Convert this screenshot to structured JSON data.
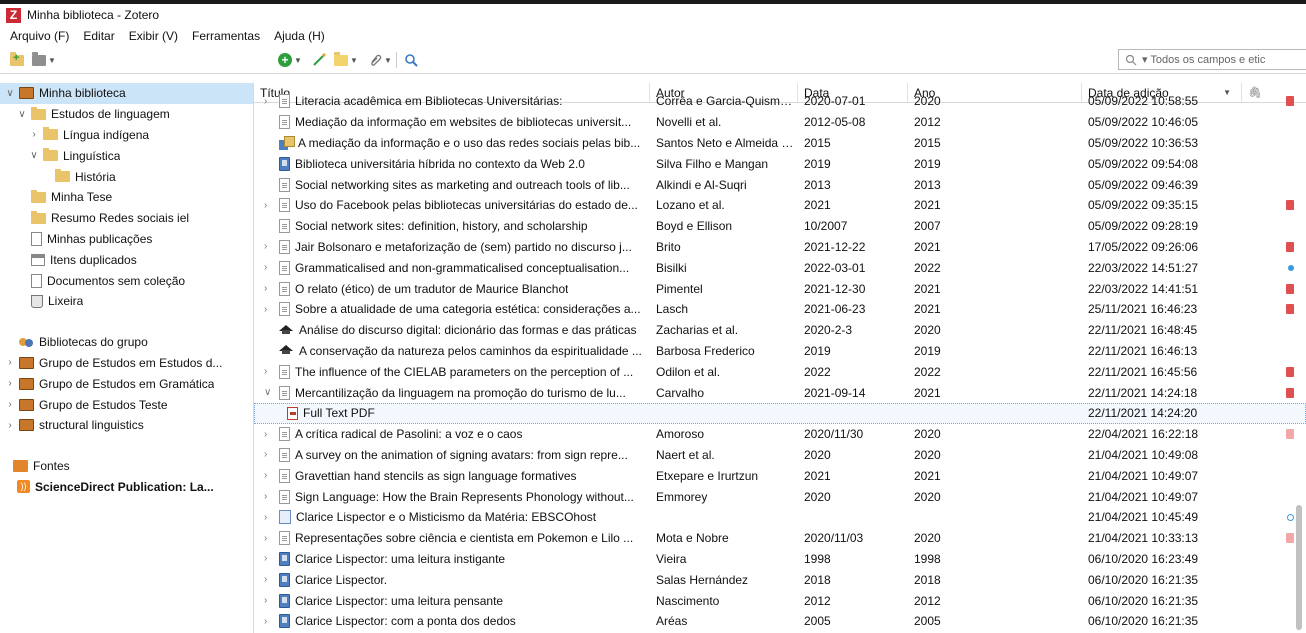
{
  "window": {
    "title": "Minha biblioteca - Zotero",
    "logo_letter": "Z"
  },
  "menu": [
    "Arquivo (F)",
    "Editar",
    "Exibir (V)",
    "Ferramentas",
    "Ajuda (H)"
  ],
  "toolbar": {
    "search_placeholder": "▾ Todos os campos e etic"
  },
  "sidebar": {
    "items": [
      {
        "label": "Minha biblioteca",
        "icon": "library-icon",
        "twisty": "∨",
        "indent": 0,
        "selected": true
      },
      {
        "label": "Estudos de linguagem",
        "icon": "folder-icon",
        "twisty": "∨",
        "indent": 1
      },
      {
        "label": "Língua indígena",
        "icon": "folder-icon",
        "twisty": "›",
        "indent": 2
      },
      {
        "label": "Linguística",
        "icon": "folder-icon",
        "twisty": "∨",
        "indent": 2
      },
      {
        "label": "História",
        "icon": "folder-icon",
        "twisty": "",
        "indent": 3
      },
      {
        "label": "Minha Tese",
        "icon": "folder-icon",
        "twisty": "",
        "indent": 1
      },
      {
        "label": "Resumo Redes sociais iel",
        "icon": "folder-icon",
        "twisty": "",
        "indent": 1
      },
      {
        "label": "Minhas publicações",
        "icon": "document-icon",
        "twisty": "",
        "indent": 1
      },
      {
        "label": "Itens duplicados",
        "icon": "duplicates-icon",
        "twisty": "",
        "indent": 1
      },
      {
        "label": "Documentos sem coleção",
        "icon": "unfiled-icon",
        "twisty": "",
        "indent": 1
      },
      {
        "label": "Lixeira",
        "icon": "trash-icon",
        "twisty": "",
        "indent": 1
      }
    ],
    "groups_header": "Bibliotecas do grupo",
    "groups": [
      "Grupo de Estudos em Estudos d...",
      "Grupo de Estudos em Gramática",
      "Grupo de Estudos Teste",
      "structural linguistics"
    ],
    "feeds_header": "Fontes",
    "feeds": [
      "ScienceDirect Publication: La..."
    ]
  },
  "columns": {
    "title": "Título",
    "author": "Autor",
    "date": "Data",
    "year": "Ano",
    "added": "Data de adição"
  },
  "rows": [
    {
      "title": "Literacia acadêmica em Bibliotecas Universitárias:",
      "author": "Corrêa e Garcia-Quismondo",
      "date": "2020-07-01",
      "year": "2020",
      "added": "05/09/2022 10:58:55",
      "type": "document",
      "twisty": "›",
      "att": "pdf",
      "partial": true
    },
    {
      "title": "Mediação da informação em websites de bibliotecas universit...",
      "author": "Novelli et al.",
      "date": "2012-05-08",
      "year": "2012",
      "added": "05/09/2022 10:46:05",
      "type": "document",
      "twisty": "",
      "att": ""
    },
    {
      "title": "A mediação da informação e o uso das redes sociais pelas bib...",
      "author": "Santos Neto e Almeida Ju...",
      "date": "2015",
      "year": "2015",
      "added": "05/09/2022 10:36:53",
      "type": "chapter",
      "twisty": "",
      "att": ""
    },
    {
      "title": "Biblioteca universitária híbrida no contexto da Web 2.0",
      "author": "Silva Filho e Mangan",
      "date": "2019",
      "year": "2019",
      "added": "05/09/2022 09:54:08",
      "type": "book",
      "twisty": "",
      "att": ""
    },
    {
      "title": "Social networking sites as marketing and outreach tools of lib...",
      "author": "Alkindi e Al-Suqri",
      "date": "2013",
      "year": "2013",
      "added": "05/09/2022 09:46:39",
      "type": "document",
      "twisty": "",
      "att": ""
    },
    {
      "title": "Uso do Facebook pelas bibliotecas universitárias do estado de...",
      "author": "Lozano et al.",
      "date": "2021",
      "year": "2021",
      "added": "05/09/2022 09:35:15",
      "type": "document",
      "twisty": "›",
      "att": "pdf"
    },
    {
      "title": "Social network sites: definition, history, and scholarship",
      "author": "Boyd e Ellison",
      "date": "10/2007",
      "year": "2007",
      "added": "05/09/2022 09:28:19",
      "type": "document",
      "twisty": "",
      "att": ""
    },
    {
      "title": "Jair Bolsonaro e metaforização de (sem) partido no discurso j...",
      "author": "Brito",
      "date": "2021-12-22",
      "year": "2021",
      "added": "17/05/2022 09:26:06",
      "type": "document",
      "twisty": "›",
      "att": "pdf"
    },
    {
      "title": "Grammaticalised and non-grammaticalised conceptualisation...",
      "author": "Bisilki",
      "date": "2022-03-01",
      "year": "2022",
      "added": "22/03/2022 14:51:27",
      "type": "document",
      "twisty": "›",
      "att": "snapshot"
    },
    {
      "title": "O relato (ético) de um tradutor de Maurice Blanchot",
      "author": "Pimentel",
      "date": "2021-12-30",
      "year": "2021",
      "added": "22/03/2022 14:41:51",
      "type": "document",
      "twisty": "›",
      "att": "pdf"
    },
    {
      "title": "Sobre a atualidade de uma categoria estética: considerações a...",
      "author": "Lasch",
      "date": "2021-06-23",
      "year": "2021",
      "added": "25/11/2021 16:46:23",
      "type": "document",
      "twisty": "›",
      "att": "pdf"
    },
    {
      "title": "Análise do discurso digital: dicionário das formas e das práticas",
      "author": "Zacharias et al.",
      "date": "2020-2-3",
      "year": "2020",
      "added": "22/11/2021 16:48:45",
      "type": "thesis",
      "twisty": "",
      "att": ""
    },
    {
      "title": "A conservação da natureza pelos caminhos da espiritualidade ...",
      "author": "Barbosa Frederico",
      "date": "2019",
      "year": "2019",
      "added": "22/11/2021 16:46:13",
      "type": "thesis",
      "twisty": "",
      "att": ""
    },
    {
      "title": "The influence of the CIELAB parameters on the perception of ...",
      "author": "Odilon et al.",
      "date": "2022",
      "year": "2022",
      "added": "22/11/2021 16:45:56",
      "type": "document",
      "twisty": "›",
      "att": "pdf"
    },
    {
      "title": "Mercantilização da linguagem na promoção do turismo de lu...",
      "author": "Carvalho",
      "date": "2021-09-14",
      "year": "2021",
      "added": "22/11/2021 14:24:18",
      "type": "document",
      "twisty": "∨",
      "att": "pdf"
    },
    {
      "title": "Full Text PDF",
      "author": "",
      "date": "",
      "year": "",
      "added": "22/11/2021 14:24:20",
      "type": "pdf",
      "twisty": "",
      "att": "",
      "child": true,
      "selected": true
    },
    {
      "title": "A crítica radical de Pasolini: a voz e o caos",
      "author": "Amoroso",
      "date": "2020/11/30",
      "year": "2020",
      "added": "22/04/2021 16:22:18",
      "type": "document",
      "twisty": "›",
      "att": "pdf-faded"
    },
    {
      "title": "A survey on the animation of signing avatars: from sign repre...",
      "author": "Naert et al.",
      "date": "2020",
      "year": "2020",
      "added": "21/04/2021 10:49:08",
      "type": "document",
      "twisty": "›",
      "att": ""
    },
    {
      "title": "Gravettian hand stencils as sign language formatives",
      "author": "Etxepare e Irurtzun",
      "date": "2021",
      "year": "2021",
      "added": "21/04/2021 10:49:07",
      "type": "document",
      "twisty": "›",
      "att": ""
    },
    {
      "title": "Sign Language: How the Brain Represents Phonology without...",
      "author": "Emmorey",
      "date": "2020",
      "year": "2020",
      "added": "21/04/2021 10:49:07",
      "type": "document",
      "twisty": "›",
      "att": ""
    },
    {
      "title": "Clarice Lispector e o Misticismo da Matéria: EBSCOhost",
      "author": "",
      "date": "",
      "year": "",
      "added": "21/04/2021 10:45:49",
      "type": "web",
      "twisty": "›",
      "att": "link"
    },
    {
      "title": "Representações sobre ciência e cientista em Pokemon e Lilo ...",
      "author": "Mota e Nobre",
      "date": "2020/11/03",
      "year": "2020",
      "added": "21/04/2021 10:33:13",
      "type": "document",
      "twisty": "›",
      "att": "pdf-faded"
    },
    {
      "title": "Clarice Lispector: uma leitura instigante",
      "author": "Vieira",
      "date": "1998",
      "year": "1998",
      "added": "06/10/2020 16:23:49",
      "type": "book",
      "twisty": "›",
      "att": ""
    },
    {
      "title": "Clarice Lispector.",
      "author": "Salas Hernández",
      "date": "2018",
      "year": "2018",
      "added": "06/10/2020 16:21:35",
      "type": "book",
      "twisty": "›",
      "att": ""
    },
    {
      "title": "Clarice Lispector: uma leitura pensante",
      "author": "Nascimento",
      "date": "2012",
      "year": "2012",
      "added": "06/10/2020 16:21:35",
      "type": "book",
      "twisty": "›",
      "att": ""
    },
    {
      "title": "Clarice Lispector: com a ponta dos dedos",
      "author": "Aréas",
      "date": "2005",
      "year": "2005",
      "added": "06/10/2020 16:21:35",
      "type": "book",
      "twisty": "›",
      "att": ""
    }
  ]
}
